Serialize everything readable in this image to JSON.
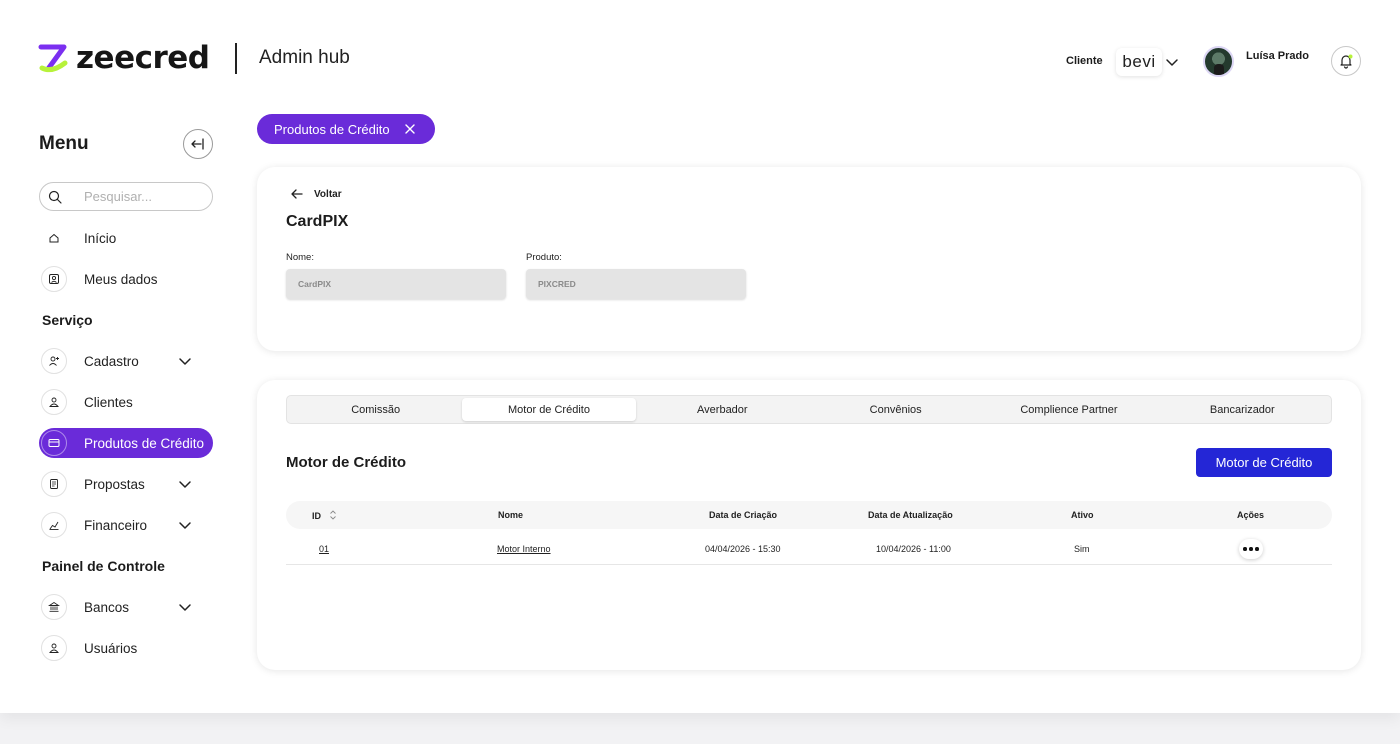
{
  "brand": {
    "name": "zeecred",
    "app_title": "Admin hub"
  },
  "header": {
    "client_label": "Cliente",
    "client_logo_text": "bevi",
    "user_name": "Luísa Prado"
  },
  "sidebar": {
    "title": "Menu",
    "search_placeholder": "Pesquisar...",
    "items": [
      {
        "label": "Início",
        "icon": "home-icon"
      },
      {
        "label": "Meus dados",
        "icon": "user-card-icon"
      },
      {
        "label": "Cadastro",
        "icon": "user-add-icon"
      },
      {
        "label": "Clientes",
        "icon": "clients-icon"
      },
      {
        "label": "Produtos de Crédito",
        "icon": "card-icon",
        "active": true
      },
      {
        "label": "Propostas",
        "icon": "document-icon"
      },
      {
        "label": "Financeiro",
        "icon": "finance-icon"
      },
      {
        "label": "Bancos",
        "icon": "bank-icon"
      },
      {
        "label": "Usuários",
        "icon": "users-icon"
      }
    ],
    "sections": {
      "servico": "Serviço",
      "painel": "Painel de Controle"
    }
  },
  "filter_chip": {
    "label": "Produtos de Crédito"
  },
  "detail": {
    "back_label": "Voltar",
    "title": "CardPIX",
    "fields": [
      {
        "label": "Nome:",
        "value": "CardPIX"
      },
      {
        "label": "Produto:",
        "value": "PIXCRED"
      }
    ]
  },
  "tabs": [
    "Comissão",
    "Motor de Crédito",
    "Averbador",
    "Convênios",
    "Complience Partner",
    "Bancarizador"
  ],
  "active_tab": "Motor de Crédito",
  "section": {
    "title": "Motor de Crédito",
    "button_label": "Motor de Crédito"
  },
  "table": {
    "columns": [
      "ID",
      "Nome",
      "Data de Criação",
      "Data de Atualização",
      "Ativo",
      "Ações"
    ],
    "rows": [
      {
        "id": "01",
        "nome": "Motor Interno",
        "criacao": "04/04/2026 - 15:30",
        "atualizacao": "10/04/2026 - 11:00",
        "ativo": "Sim"
      }
    ]
  },
  "colors": {
    "accent": "#6a2bd9",
    "primary_button": "#2426d6",
    "logo_lime": "#b7f23a"
  }
}
